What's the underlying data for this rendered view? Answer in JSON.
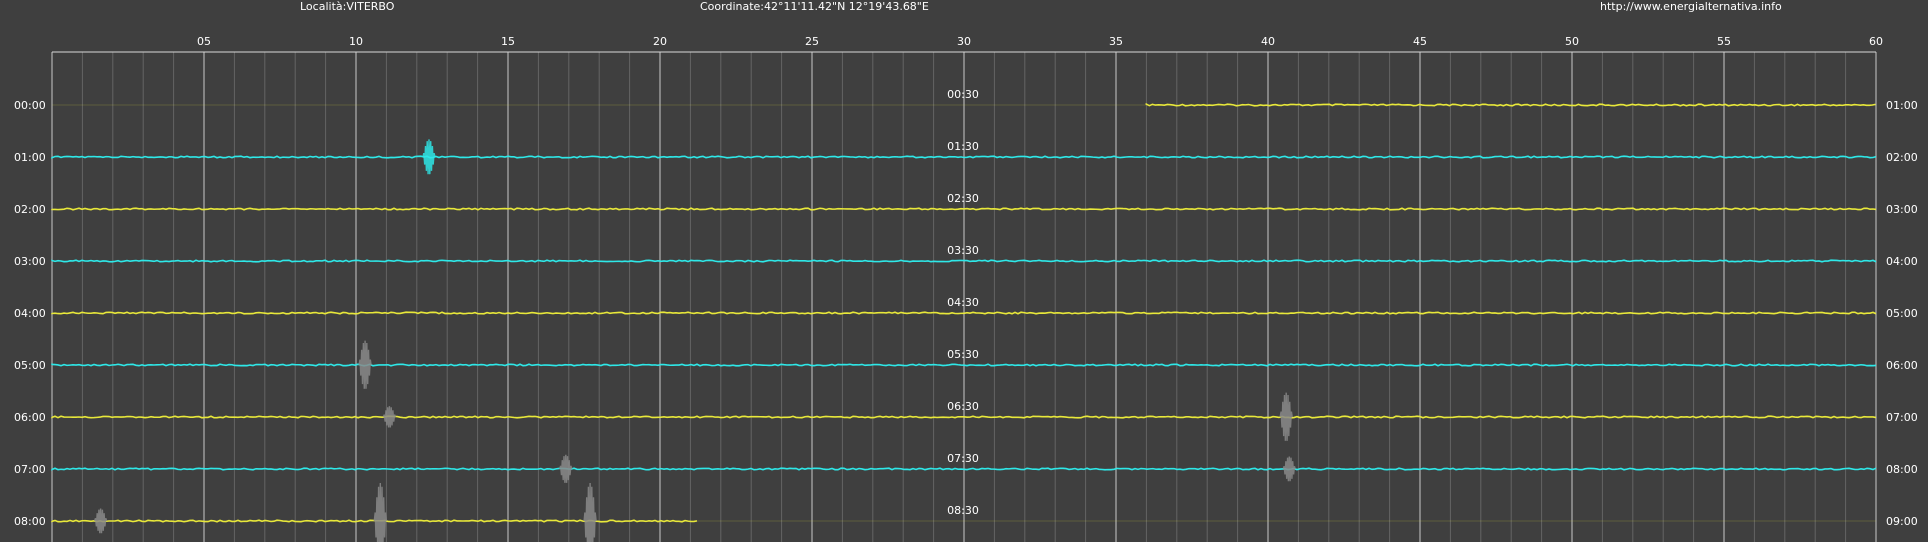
{
  "header": {
    "location": "Località:VITERBO",
    "coordinates": "Coordinate:42°11'11.42\"N  12°19'43.68\"E",
    "url": "http://www.energialternativa.info"
  },
  "colors": {
    "background": "#3f3f3f",
    "grid_major": "#d8d8d8",
    "grid_minor": "#6e6e6e",
    "trace_yellow": "#e8e83a",
    "trace_cyan": "#2ee8e8",
    "event_grey": "#8a8a8a",
    "text": "#ffffff"
  },
  "chart_data": {
    "type": "line",
    "title": "",
    "x_axis": {
      "unit": "minutes",
      "range": [
        0,
        60
      ],
      "tick_labels": [
        "05",
        "10",
        "15",
        "20",
        "25",
        "30",
        "35",
        "40",
        "45",
        "50",
        "55",
        "60"
      ]
    },
    "grid": true,
    "rows": [
      {
        "left_label": "00:00",
        "right_label": "01:00",
        "mid_label": "00:30",
        "color": "yellow",
        "data_start_min": 36,
        "data_end_min": 60
      },
      {
        "left_label": "01:00",
        "right_label": "02:00",
        "mid_label": "01:30",
        "color": "cyan",
        "data_start_min": 0,
        "data_end_min": 60
      },
      {
        "left_label": "02:00",
        "right_label": "03:00",
        "mid_label": "02:30",
        "color": "yellow",
        "data_start_min": 0,
        "data_end_min": 60
      },
      {
        "left_label": "03:00",
        "right_label": "04:00",
        "mid_label": "03:30",
        "color": "cyan",
        "data_start_min": 0,
        "data_end_min": 60
      },
      {
        "left_label": "04:00",
        "right_label": "05:00",
        "mid_label": "04:30",
        "color": "yellow",
        "data_start_min": 0,
        "data_end_min": 60
      },
      {
        "left_label": "05:00",
        "right_label": "06:00",
        "mid_label": "05:30",
        "color": "cyan",
        "data_start_min": 0,
        "data_end_min": 60
      },
      {
        "left_label": "06:00",
        "right_label": "07:00",
        "mid_label": "06:30",
        "color": "yellow",
        "data_start_min": 0,
        "data_end_min": 60
      },
      {
        "left_label": "07:00",
        "right_label": "08:00",
        "mid_label": "07:30",
        "color": "cyan",
        "data_start_min": 0,
        "data_end_min": 60
      },
      {
        "left_label": "08:00",
        "right_label": "09:00",
        "mid_label": "08:30",
        "color": "yellow",
        "data_start_min": 0,
        "data_end_min": 21.3
      }
    ],
    "events": [
      {
        "row": 1,
        "minute": 12.4,
        "amplitude": 0.4,
        "color": "cyan"
      },
      {
        "row": 5,
        "minute": 10.3,
        "amplitude": 0.6,
        "color": "grey"
      },
      {
        "row": 6,
        "minute": 40.6,
        "amplitude": 0.6,
        "color": "grey"
      },
      {
        "row": 6,
        "minute": 11.1,
        "amplitude": 0.2,
        "color": "grey"
      },
      {
        "row": 7,
        "minute": 16.9,
        "amplitude": 0.3,
        "color": "grey"
      },
      {
        "row": 7,
        "minute": 40.7,
        "amplitude": 0.25,
        "color": "grey"
      },
      {
        "row": 8,
        "minute": 10.8,
        "amplitude": 1.0,
        "color": "grey"
      },
      {
        "row": 8,
        "minute": 17.7,
        "amplitude": 1.0,
        "color": "grey"
      },
      {
        "row": 8,
        "minute": 1.6,
        "amplitude": 0.25,
        "color": "grey"
      }
    ]
  }
}
